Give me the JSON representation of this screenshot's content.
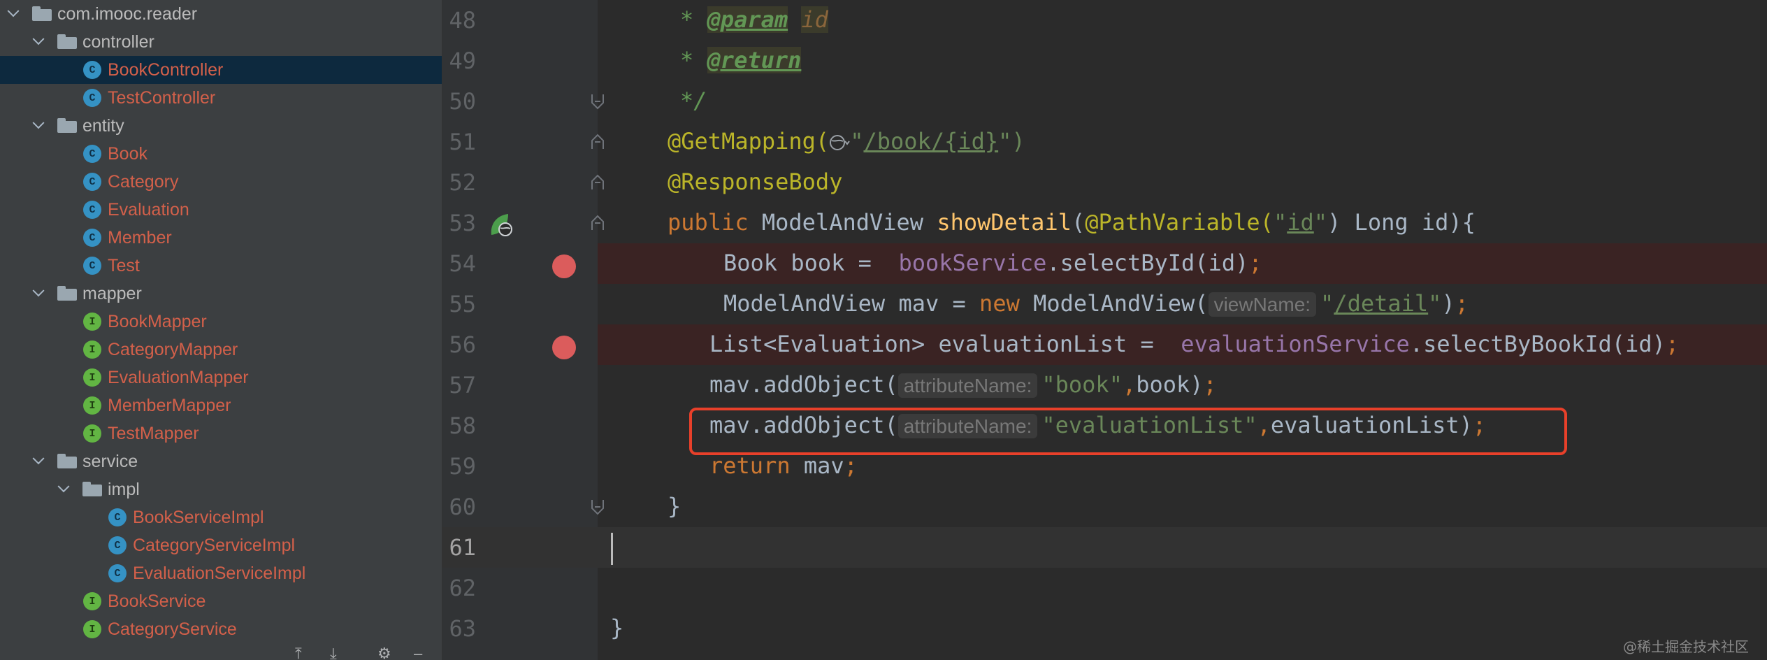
{
  "project_tree": {
    "items": [
      {
        "label": "com.imooc.reader",
        "kind": "package"
      },
      {
        "label": "controller",
        "kind": "package"
      },
      {
        "label": "BookController",
        "kind": "class"
      },
      {
        "label": "TestController",
        "kind": "class"
      },
      {
        "label": "entity",
        "kind": "package"
      },
      {
        "label": "Book",
        "kind": "class"
      },
      {
        "label": "Category",
        "kind": "class"
      },
      {
        "label": "Evaluation",
        "kind": "class"
      },
      {
        "label": "Member",
        "kind": "class"
      },
      {
        "label": "Test",
        "kind": "class"
      },
      {
        "label": "mapper",
        "kind": "package"
      },
      {
        "label": "BookMapper",
        "kind": "interface"
      },
      {
        "label": "CategoryMapper",
        "kind": "interface"
      },
      {
        "label": "EvaluationMapper",
        "kind": "interface"
      },
      {
        "label": "MemberMapper",
        "kind": "interface"
      },
      {
        "label": "TestMapper",
        "kind": "interface"
      },
      {
        "label": "service",
        "kind": "package"
      },
      {
        "label": "impl",
        "kind": "package"
      },
      {
        "label": "BookServiceImpl",
        "kind": "class"
      },
      {
        "label": "CategoryServiceImpl",
        "kind": "class"
      },
      {
        "label": "EvaluationServiceImpl",
        "kind": "class"
      },
      {
        "label": "BookService",
        "kind": "interface"
      },
      {
        "label": "CategoryService",
        "kind": "interface"
      }
    ],
    "class_badge": "C",
    "interface_badge": "I",
    "selected_item": "BookController"
  },
  "editor": {
    "line_numbers": [
      "48",
      "49",
      "50",
      "51",
      "52",
      "53",
      "54",
      "55",
      "56",
      "57",
      "58",
      "59",
      "60",
      "61",
      "62",
      "63"
    ],
    "current_line": "61",
    "breakpoint_lines": [
      "54",
      "56"
    ],
    "highlighted_line": "58",
    "code": {
      "l48_star": "* ",
      "l48_tag": "@param",
      "l48_param": "id",
      "l49_star": "* ",
      "l49_tag": "@return",
      "l50": "*/",
      "l51_ann": "@GetMapping(",
      "l51_url": "/book/{id}",
      "l51_close": "\")",
      "l52_ann": "@ResponseBody",
      "l53_public": "public ",
      "l53_type": "ModelAndView ",
      "l53_method": "showDetail",
      "l53_paren": "(",
      "l53_ann": "@PathVariable(",
      "l53_q1": "\"",
      "l53_id": "id",
      "l53_q2": "\"",
      "l53_rest": ") Long id){",
      "l54_a": "Book book =  ",
      "l54_field": "bookService",
      "l54_b": ".selectById(id)",
      "l54_semi": ";",
      "l55_a": "ModelAndView mav = ",
      "l55_new": "new ",
      "l55_b": "ModelAndView(",
      "l55_hint": "viewName:",
      "l55_q1": "\"",
      "l55_url": "/detail",
      "l55_q2": "\"",
      "l55_c": ")",
      "l55_semi": ";",
      "l56_a": "List<Evaluation> evaluationList =  ",
      "l56_field": "evaluationService",
      "l56_b": ".selectByBookId(id)",
      "l56_semi": ";",
      "l57_a": "mav.addObject(",
      "l57_hint": "attributeName:",
      "l57_str": "\"book\"",
      "l57_comma": ",",
      "l57_b": "book)",
      "l57_semi": ";",
      "l58_a": "mav.addObject(",
      "l58_hint": "attributeName:",
      "l58_str": "\"evaluationList\"",
      "l58_comma": ",",
      "l58_b": "evaluationList)",
      "l58_semi": ";",
      "l59_kw": "return ",
      "l59_a": "mav",
      "l59_semi": ";",
      "l60": "}",
      "l63": "}"
    }
  },
  "watermark": "@稀土掘金技术社区",
  "colors": {
    "keyword": "#cc7832",
    "annotation": "#bbb529",
    "string": "#6a8759",
    "method": "#ffc66d",
    "field": "#9876aa",
    "breakpoint": "#db5c5c",
    "highlight_box": "#e8402a"
  }
}
